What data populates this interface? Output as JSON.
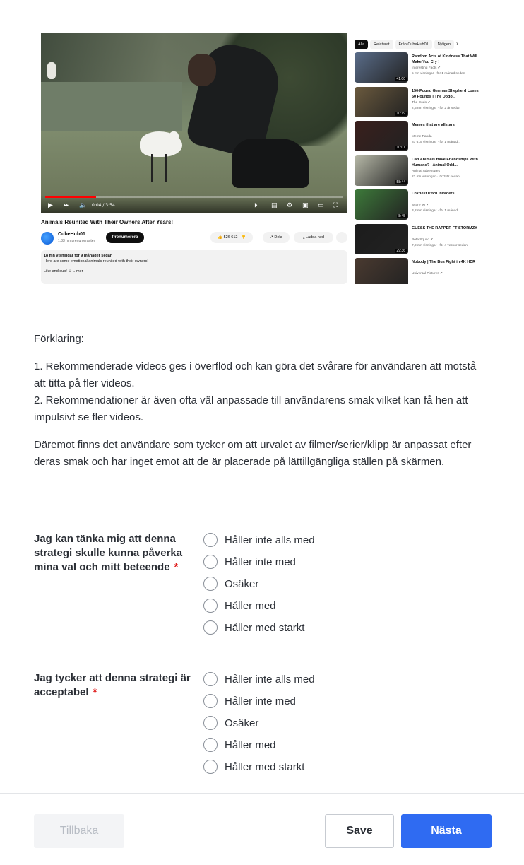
{
  "video_screenshot": {
    "player": {
      "time": "0:04 / 3:54",
      "progress": 0.17
    },
    "video_title": "Animals Reunited With Their Owners After Years!",
    "channel": {
      "name": "CubeHub01",
      "subscribers": "1,33 mn prenumeranter",
      "subscribe_label": "Prenumerera"
    },
    "actions": {
      "likes": "526 612",
      "share": "Dela",
      "download": "Ladda ned",
      "more": "···"
    },
    "description": {
      "stats": "18 mn visningar  för 9 månader sedan",
      "line1": "Here are some emotional animals reunited with their owners!",
      "line2": "Like and sub! ☺  ...mer"
    },
    "chips": [
      "Alla",
      "Relaterat",
      "Från CubeHub01",
      "Nyligen"
    ],
    "recommendations": [
      {
        "title": "Random Acts of Kindness That Will Make You Cry !",
        "channel": "Interesting Facts ✔",
        "meta": "5 mn visningar · för 1 månad sedan",
        "duration": "41:00",
        "color": "#5a6d8a"
      },
      {
        "title": "150-Pound German Shepherd Loses 50 Pounds | The Dodo...",
        "channel": "The Dodo ✔",
        "meta": "2,5 mn visningar · för 2 år sedan",
        "duration": "10:19",
        "color": "#6b5a3e"
      },
      {
        "title": "Memes that are allstars",
        "channel": "Meme Panda",
        "meta": "87 615 visningar · för 1 månad...",
        "duration": "10:01",
        "color": "#3a1f1c"
      },
      {
        "title": "Can Animals Have Friendships With Humans? | Animal Odd...",
        "channel": "Animal Adventures",
        "meta": "22 mn visningar · för 3 år sedan",
        "duration": "58:44",
        "color": "#b7b9a8"
      },
      {
        "title": "Craziest Pitch Invaders",
        "channel": "Score 90 ✔",
        "meta": "3,2 mn visningar · för 1 månad...",
        "duration": "8:45",
        "color": "#3d7a3a"
      },
      {
        "title": "GUESS THE RAPPER FT STORMZY",
        "channel": "Beta Squad ✔",
        "meta": "7,9 mn visningar · för 4 veckor sedan",
        "duration": "29:36",
        "color": "#1c1c1c"
      },
      {
        "title": "Nobody | The Bus Fight in 4K HDR",
        "channel": "Universal Pictures ✔",
        "meta": "",
        "duration": "",
        "color": "#4a3a30"
      }
    ]
  },
  "explanation": {
    "heading": "Förklaring:",
    "point1": "1. Rekommenderade videos ges i överflöd och kan göra det svårare för användaren att motstå att titta på fler videos.",
    "point2": "2. Rekommendationer är även ofta väl anpassade till användarens smak vilket kan få hen att impulsivt se fler videos.",
    "counter": "Däremot finns det användare som tycker om att urvalet av filmer/serier/klipp är anpassat efter deras smak och har inget emot att de är placerade på lättillgängliga ställen på skärmen."
  },
  "questions": [
    {
      "label": "Jag kan tänka mig att denna strategi skulle kunna påverka mina val och mitt beteende",
      "required": "*",
      "options": [
        "Håller inte alls med",
        "Håller inte med",
        "Osäker",
        "Håller med",
        "Håller med starkt"
      ]
    },
    {
      "label": "Jag tycker att denna strategi är acceptabel",
      "required": "*",
      "options": [
        "Håller inte alls med",
        "Håller inte med",
        "Osäker",
        "Håller med",
        "Håller med starkt"
      ]
    }
  ],
  "footer": {
    "back_label": "Tillbaka",
    "save_label": "Save",
    "next_label": "Nästa"
  }
}
